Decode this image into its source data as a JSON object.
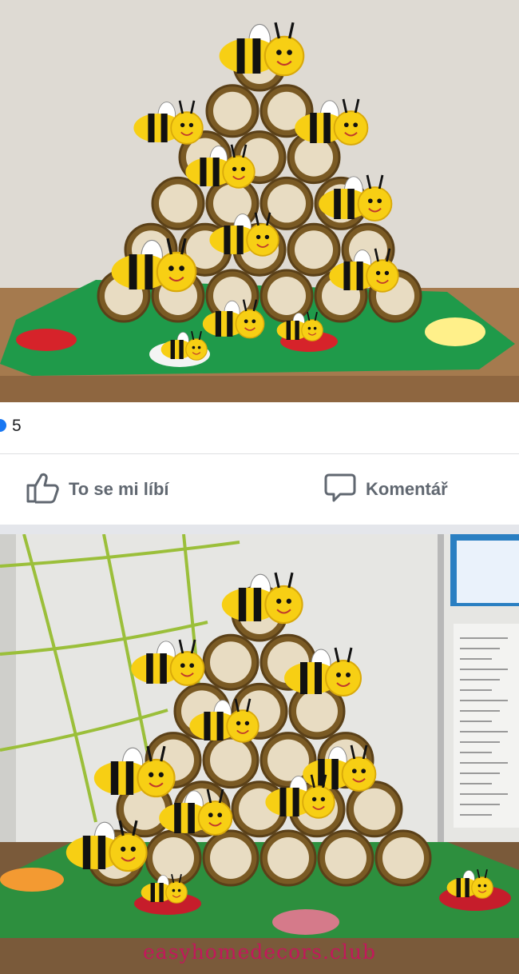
{
  "post": {
    "reaction_count": "5",
    "actions": {
      "like_label": "To se mi líbí",
      "comment_label": "Komentář"
    }
  },
  "watermark": "easyhomedecors.club",
  "icons": {
    "reaction": "like-reaction-icon",
    "like": "thumbs-up-icon",
    "comment": "speech-bubble-icon"
  },
  "colors": {
    "accent": "#1877f2",
    "action_text": "#606770",
    "watermark": "#c2185b"
  }
}
